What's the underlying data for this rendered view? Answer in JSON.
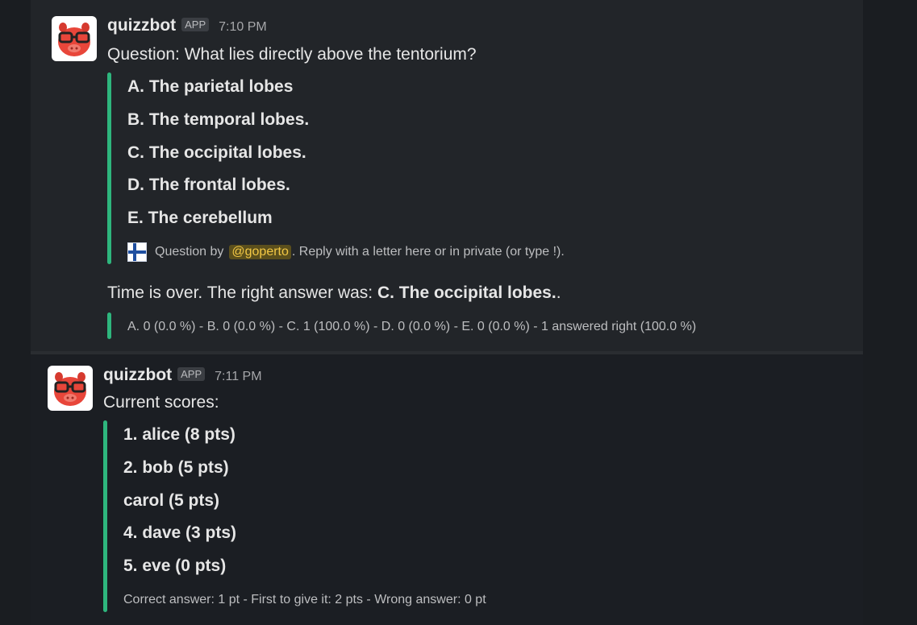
{
  "messages": [
    {
      "username": "quizzbot",
      "badge": "APP",
      "time": "7:10 PM",
      "question": "Question: What lies directly above the tentorium?",
      "options": [
        "A. The parietal lobes",
        "B. The temporal lobes.",
        "C. The occipital lobes.",
        "D. The frontal lobes.",
        "E. The cerebellum"
      ],
      "footer_prefix": "Question by",
      "footer_mention": "@goperto",
      "footer_suffix": ". Reply with a letter here or in private (or type !).",
      "result_prefix": "Time is over. The right answer was: ",
      "result_answer": "C. The occipital lobes.",
      "result_suffix": ".",
      "stats": "A. 0 (0.0 %) - B. 0 (0.0 %) - C. 1 (100.0 %) - D. 0 (0.0 %) - E. 0 (0.0 %) - 1 answered right (100.0 %)"
    },
    {
      "username": "quizzbot",
      "badge": "APP",
      "time": "7:11 PM",
      "title": "Current scores:",
      "scores": [
        "1.  alice (8 pts)",
        "2.  bob (5 pts)",
        "carol (5 pts)",
        "4.  dave (3 pts)",
        "5.  eve (0 pts)"
      ],
      "rules": "Correct answer: 1 pt - First to give it: 2 pts - Wrong answer: 0 pt"
    }
  ],
  "colors": {
    "accent_bar": "#2eb67d",
    "mention_bg": "#5b4f1c",
    "mention_fg": "#f2c744"
  },
  "icons": {
    "avatar": "red-pig-with-glasses-icon",
    "flag": "finland-flag-icon"
  }
}
